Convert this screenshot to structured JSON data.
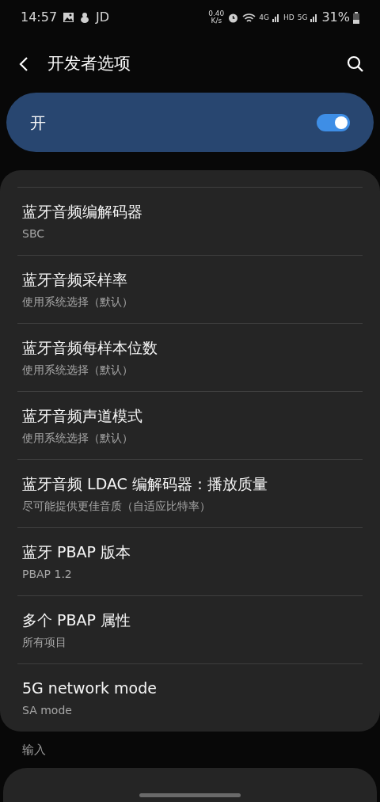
{
  "status_bar": {
    "time": "14:57",
    "carrier": "JD",
    "speed_value": "0.40",
    "speed_unit": "K/s",
    "sim1_network": "4G",
    "hd": "HD",
    "sim2_network": "5G",
    "battery": "31%"
  },
  "header": {
    "title": "开发者选项"
  },
  "master_switch": {
    "label": "开",
    "on": true
  },
  "settings": [
    {
      "title": "蓝牙音频编解码器",
      "summary": "SBC"
    },
    {
      "title": "蓝牙音频采样率",
      "summary": "使用系统选择（默认）"
    },
    {
      "title": "蓝牙音频每样本位数",
      "summary": "使用系统选择（默认）"
    },
    {
      "title": "蓝牙音频声道模式",
      "summary": "使用系统选择（默认）"
    },
    {
      "title": "蓝牙音频 LDAC 编解码器：播放质量",
      "summary": "尽可能提供更佳音质（自适应比特率）"
    },
    {
      "title": "蓝牙 PBAP 版本",
      "summary": "PBAP 1.2"
    },
    {
      "title": "多个 PBAP 属性",
      "summary": "所有项目"
    },
    {
      "title": "5G network mode",
      "summary": "SA mode"
    }
  ],
  "section": {
    "label": "输入"
  }
}
